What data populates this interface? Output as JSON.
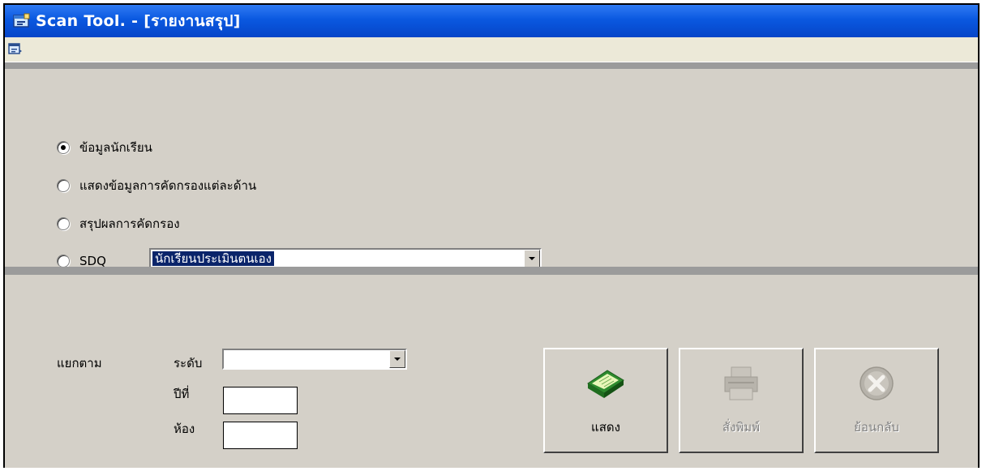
{
  "window": {
    "title": "Scan Tool. - [รายงานสรุป]"
  },
  "icons": {
    "title": "app-window-icon",
    "menu": "document-icon"
  },
  "report_options": [
    {
      "label": "ข้อมูลนักเรียน",
      "checked": true
    },
    {
      "label": "แสดงข้อมูลการคัดกรองแต่ละด้าน",
      "checked": false
    },
    {
      "label": "สรุปผลการคัดกรอง",
      "checked": false
    },
    {
      "label": "SDQ",
      "checked": false
    }
  ],
  "sdq_select": {
    "value": "นักเรียนประเมินตนเอง"
  },
  "filter": {
    "group_label": "แยกตาม",
    "level_label": "ระดับ",
    "level_value": "",
    "year_label": "ปีที่",
    "year_value": "",
    "room_label": "ห้อง",
    "room_value": ""
  },
  "buttons": {
    "show": {
      "label": "แสดง",
      "enabled": true,
      "icon": "book-icon"
    },
    "print": {
      "label": "สั่งพิมพ์",
      "enabled": false,
      "icon": "printer-icon"
    },
    "back": {
      "label": "ย้อนกลับ",
      "enabled": false,
      "icon": "cancel-icon"
    }
  },
  "colors": {
    "titlebar": "#0a58e0",
    "face": "#d4d0c8",
    "selection": "#0a246a",
    "separator": "#9b9b9b"
  }
}
